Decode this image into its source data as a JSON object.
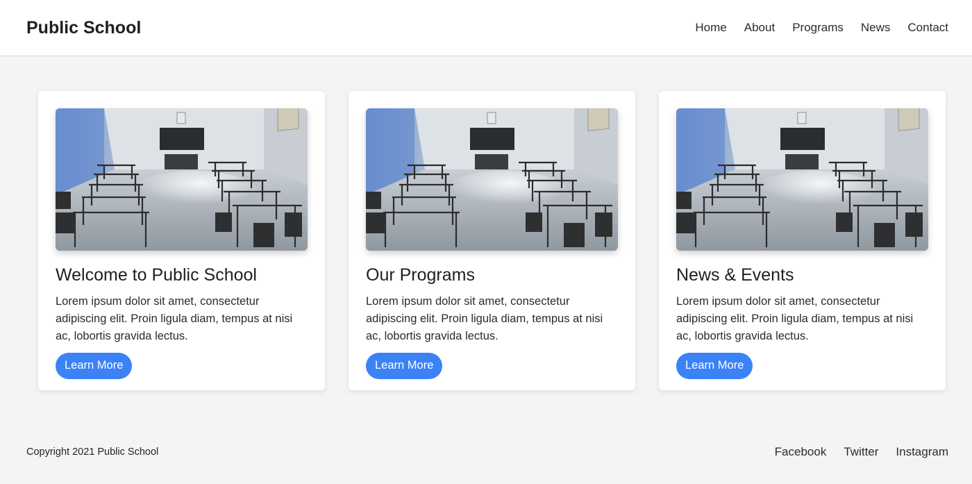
{
  "header": {
    "brand": "Public School",
    "nav": [
      "Home",
      "About",
      "Programs",
      "News",
      "Contact"
    ]
  },
  "cards": [
    {
      "title": "Welcome to Public School",
      "body": "Lorem ipsum dolor sit amet, consectetur adipiscing elit. Proin ligula diam, tempus at nisi ac, lobortis gravida lectus.",
      "button": "Learn More"
    },
    {
      "title": "Our Programs",
      "body": "Lorem ipsum dolor sit amet, consectetur adipiscing elit. Proin ligula diam, tempus at nisi ac, lobortis gravida lectus.",
      "button": "Learn More"
    },
    {
      "title": "News & Events",
      "body": "Lorem ipsum dolor sit amet, consectetur adipiscing elit. Proin ligula diam, tempus at nisi ac, lobortis gravida lectus.",
      "button": "Learn More"
    }
  ],
  "footer": {
    "copyright": "Copyright 2021 Public School",
    "social": [
      "Facebook",
      "Twitter",
      "Instagram"
    ]
  },
  "colors": {
    "accent": "#3b82f6",
    "background": "#f3f4f6",
    "surface": "#ffffff"
  }
}
